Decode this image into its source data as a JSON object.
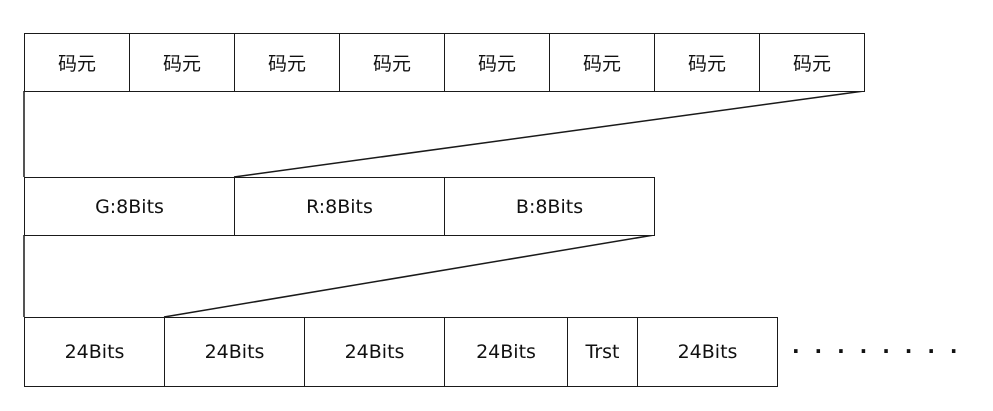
{
  "row1": {
    "cells": [
      "码元",
      "码元",
      "码元",
      "码元",
      "码元",
      "码元",
      "码元",
      "码元"
    ]
  },
  "row2": {
    "cells": [
      "G:8Bits",
      "R:8Bits",
      "B:8Bits"
    ]
  },
  "row3": {
    "cells": [
      "24Bits",
      "24Bits",
      "24Bits",
      "24Bits",
      "Trst",
      "24Bits"
    ],
    "continuation": "· · · · · · · · · · · ·"
  },
  "colors": {
    "stroke": "#1a1a1a",
    "text": "#111111",
    "background": "#ffffff"
  }
}
